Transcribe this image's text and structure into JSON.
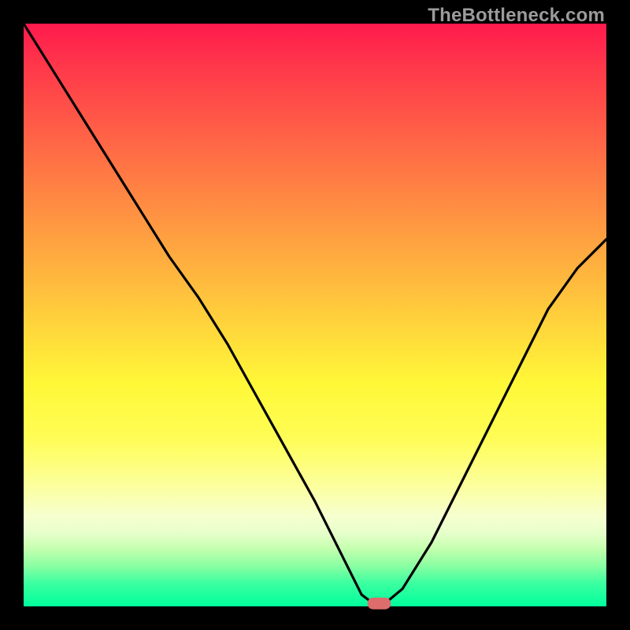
{
  "watermark": "TheBottleneck.com",
  "colors": {
    "background": "#000000",
    "curve": "#000000",
    "marker": "#dd6c6c",
    "gradient_top": "#ff1a4d",
    "gradient_bottom": "#00ff9c"
  },
  "chart_data": {
    "type": "line",
    "title": "",
    "xlabel": "",
    "ylabel": "",
    "xlim": [
      0,
      100
    ],
    "ylim": [
      0,
      100
    ],
    "x": [
      0,
      5,
      10,
      15,
      20,
      25,
      30,
      35,
      40,
      45,
      50,
      55,
      58,
      60,
      62,
      65,
      70,
      75,
      80,
      85,
      90,
      95,
      100
    ],
    "values": [
      100,
      92,
      84,
      76,
      68,
      60,
      53,
      45,
      36,
      27,
      18,
      8,
      2,
      0.5,
      0.5,
      3,
      11,
      21,
      31,
      41,
      51,
      58,
      63
    ],
    "marker": {
      "x": 61,
      "y": 0.5,
      "width": 4,
      "height": 2
    },
    "legend": null,
    "grid": false
  }
}
